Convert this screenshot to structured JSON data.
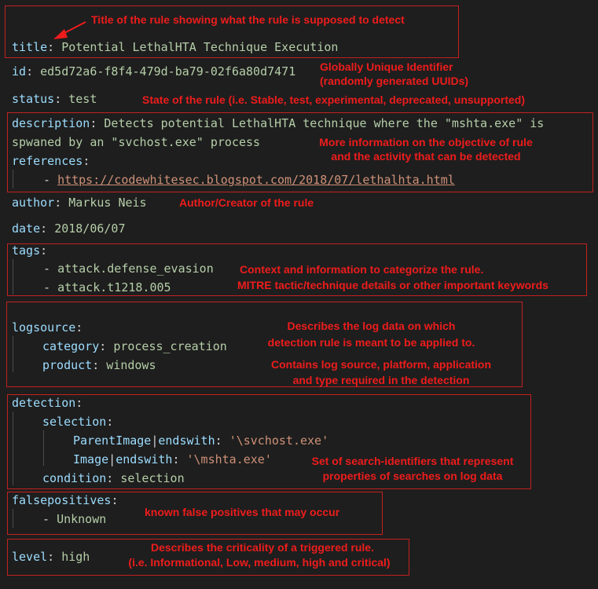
{
  "yaml": {
    "title_key": "title",
    "title_value": "Potential LethalHTA Technique Execution",
    "id_key": "id",
    "id_value": "ed5d72a6-f8f4-479d-ba79-02f6a80d7471",
    "status_key": "status",
    "status_value": "test",
    "description_key": "description",
    "description_line1": "Detects potential LethalHTA technique where the \"mshta.exe\" is",
    "description_line2": "spwaned by an \"svchost.exe\" process",
    "references_key": "references",
    "reference_url": "https://codewhitesec.blogspot.com/2018/07/lethalhta.html",
    "author_key": "author",
    "author_value": "Markus Neis",
    "date_key": "date",
    "date_value": "2018/06/07",
    "tags_key": "tags",
    "tags": [
      "attack.defense_evasion",
      "attack.t1218.005"
    ],
    "logsource_key": "logsource",
    "category_key": "category",
    "category_value": "process_creation",
    "product_key": "product",
    "product_value": "windows",
    "detection_key": "detection",
    "selection_key": "selection",
    "parentimage_key": "ParentImage",
    "parentimage_mod": "endswith",
    "parentimage_value": "'\\svchost.exe'",
    "image_key": "Image",
    "image_mod": "endswith",
    "image_value": "'\\mshta.exe'",
    "condition_key": "condition",
    "condition_value": "selection",
    "falsepositives_key": "falsepositives",
    "falsepositive_item": "Unknown",
    "level_key": "level",
    "level_value": "high"
  },
  "annotations": {
    "title": "Title of the rule showing what the rule is supposed to detect",
    "id_line1": "Globally Unique Identifier",
    "id_line2": "(randomly generated UUIDs)",
    "status": "State of the rule (i.e. Stable, test, experimental, deprecated, unsupported)",
    "description_line1": "More information on the objective of rule",
    "description_line2": "and the activity that can be detected",
    "author": "Author/Creator of the rule",
    "tags_line1": "Context and information to categorize the rule.",
    "tags_line2": "MITRE tactic/technique  details or other important keywords",
    "logsource_line1": "Describes the log data on which",
    "logsource_line2": "detection rule is meant to be applied to.",
    "logsource_line3": "Contains log source, platform, application",
    "logsource_line4": "and type required in the detection",
    "detection_line1": "Set of search-identifiers that represent",
    "detection_line2": "properties of searches on log data",
    "falsepositives": "known false positives that may occur",
    "level_line1": "Describes the criticality of a triggered rule.",
    "level_line2": "(i.e. Informational, Low, medium, high and critical)"
  },
  "colors": {
    "background": "#1e1e1e",
    "key": "#9cdcfe",
    "string": "#ce9178",
    "value": "#b5cea8",
    "annotation": "#ee1c1c"
  }
}
